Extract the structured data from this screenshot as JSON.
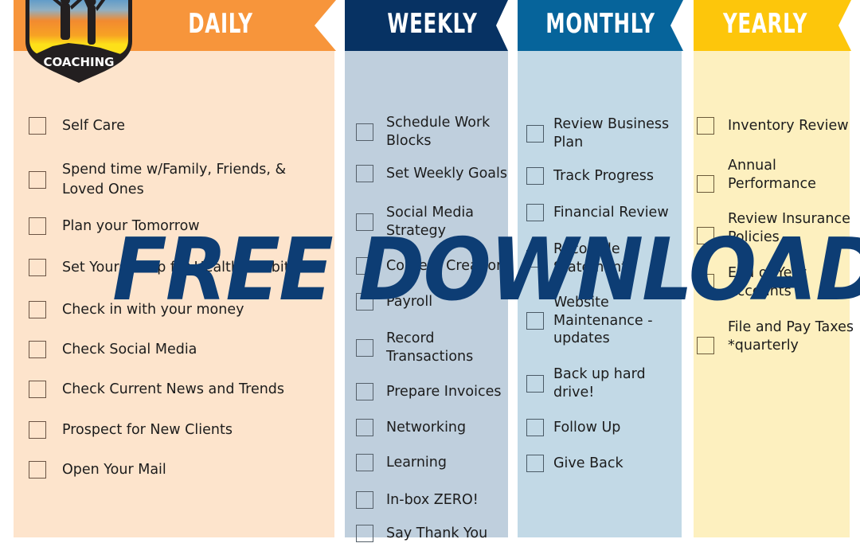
{
  "logo": {
    "label": "COACHING"
  },
  "overlay": {
    "text": "FREE DOWNLOAD!",
    "color": "#0d3d74"
  },
  "columns": [
    {
      "key": "daily",
      "title": "DAILY",
      "banner_color": "#f7953b",
      "body_color": "#fde4cc",
      "items": [
        "Self Care",
        "Spend time w/Family, Friends, & Loved Ones",
        "Plan your Tomorrow",
        "Set Yourself up for Healthy Habits",
        "Check in with your money",
        "Check Social Media",
        "Check Current News and Trends",
        "Prospect for New Clients",
        "Open Your Mail"
      ]
    },
    {
      "key": "weekly",
      "title": "WEEKLY",
      "banner_color": "#073263",
      "body_color": "#bfcfdd",
      "items": [
        "Schedule Work Blocks",
        "Set Weekly Goals",
        "Social Media Strategy",
        "Content Creation",
        "Payroll",
        "Record Transactions",
        "Prepare Invoices",
        "Networking",
        "Learning",
        "In-box ZERO!",
        "Say Thank You"
      ]
    },
    {
      "key": "monthly",
      "title": "MONTHLY",
      "banner_color": "#06649b",
      "body_color": "#c2d9e6",
      "items": [
        "Review Business Plan",
        "Track Progress",
        "Financial Review",
        "Reconcile Statements",
        "Website Maintenance - updates",
        "Back up hard drive!",
        "Follow Up",
        "Give Back"
      ]
    },
    {
      "key": "yearly",
      "title": "YEARLY",
      "banner_color": "#fdc60b",
      "body_color": "#fdf0bf",
      "items": [
        "Inventory Review",
        "Annual Performance",
        "Review Insurance Policies",
        "End of Year Accounts",
        "File and Pay Taxes *quarterly"
      ]
    }
  ]
}
